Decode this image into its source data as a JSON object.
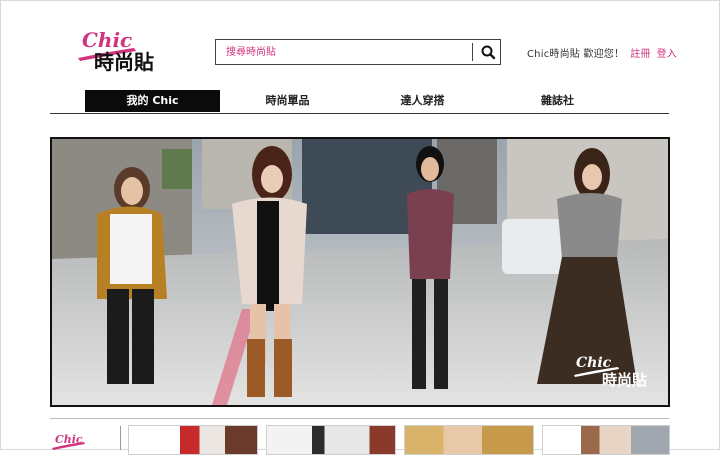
{
  "brand": {
    "logo_script": "Chic",
    "logo_text": "時尚貼"
  },
  "search": {
    "placeholder": "搜尋時尚貼",
    "button_icon": "search-icon"
  },
  "account": {
    "greeting": "Chic時尚貼 歡迎您！",
    "register_label": "註冊",
    "login_label": "登入"
  },
  "nav": {
    "items": [
      {
        "label": "我的 Chic",
        "active": true
      },
      {
        "label": "時尚單品",
        "active": false
      },
      {
        "label": "達人穿搭",
        "active": false
      },
      {
        "label": "雜誌社",
        "active": false
      }
    ]
  },
  "hero": {
    "overlay_logo_script": "Chic",
    "overlay_logo_text": "時尚貼"
  },
  "strip": {
    "logo_script": "Chic",
    "thumbnails": [
      "thumb-1",
      "thumb-2",
      "thumb-3",
      "thumb-4"
    ]
  },
  "colors": {
    "accent": "#d1337f",
    "nav_active_bg": "#0b0b0b",
    "border_dark": "#111111"
  }
}
